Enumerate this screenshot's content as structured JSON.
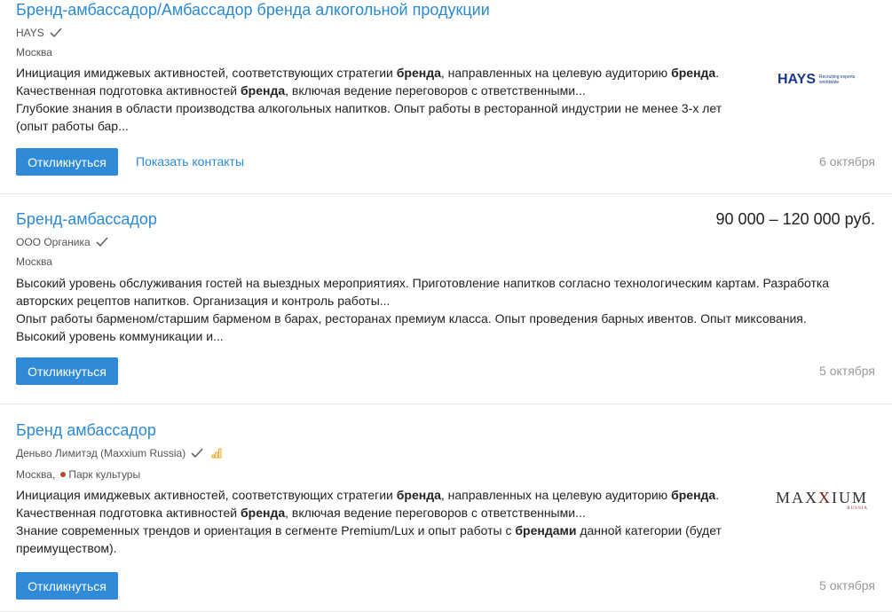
{
  "vacancies": [
    {
      "title": "Бренд-амбассадор/Амбассадор бренда алкогольной продукции",
      "company": "HAYS",
      "location": "Москва",
      "description": [
        [
          {
            "t": "Инициация имиджевых активностей, соответствующих стратегии "
          },
          {
            "t": "бренда",
            "b": true
          },
          {
            "t": ", направленных на целевую аудиторию "
          },
          {
            "t": "бренда",
            "b": true
          },
          {
            "t": "."
          }
        ],
        [
          {
            "t": "Качественная подготовка активностей "
          },
          {
            "t": "бренда",
            "b": true
          },
          {
            "t": ", включая ведение переговоров с ответственными..."
          }
        ],
        [
          {
            "t": "Глубокие знания в области производства алкогольных напитков. Опыт работы в ресторанной индустрии не менее 3-х лет (опыт работы бар..."
          }
        ]
      ],
      "apply_label": "Откликнуться",
      "contacts_label": "Показать контакты",
      "date": "6 октября",
      "logo": {
        "word": "HAYS",
        "tagline": "Recruiting experts worldwide"
      }
    },
    {
      "title": "Бренд-амбассадор",
      "salary": "90 000 – 120 000 руб.",
      "company": "ООО Органика",
      "location": "Москва",
      "description": [
        [
          {
            "t": "Высокий уровень обслуживания гостей на выездных мероприятиях. Приготовление напитков согласно технологическим картам. Разработка авторских рецептов напитков. Организация и контроль работы..."
          }
        ],
        [
          {
            "t": "Опыт работы барменом/старшим барменом в барах, ресторанах премиум класса. Опыт проведения барных ивентов. Опыт миксования. Высокий уровень коммуникации и..."
          }
        ]
      ],
      "apply_label": "Откликнуться",
      "date": "5 октября"
    },
    {
      "title": "Бренд амбассадор",
      "company": "Деньво Лимитэд (Maxxium Russia)",
      "location": "Москва,",
      "metro": "Парк культуры",
      "description": [
        [
          {
            "t": "Инициация имиджевых активностей, соответствующих стратегии "
          },
          {
            "t": "бренда",
            "b": true
          },
          {
            "t": ", направленных на целевую аудиторию "
          },
          {
            "t": "бренда",
            "b": true
          },
          {
            "t": "."
          }
        ],
        [
          {
            "t": "Качественная подготовка активностей "
          },
          {
            "t": "бренда",
            "b": true
          },
          {
            "t": ", включая ведение переговоров с ответственными..."
          }
        ],
        [
          {
            "t": "Знание современных трендов и ориентация в сегменте Premium/Lux и опыт работы с "
          },
          {
            "t": "брендами",
            "b": true
          },
          {
            "t": " данной категории (будет преимуществом)."
          }
        ]
      ],
      "apply_label": "Откликнуться",
      "date": "5 октября",
      "logo": {
        "word_a": "MAX",
        "word_x": "X",
        "word_b": "IUM",
        "sub": "RUSSIA"
      }
    }
  ],
  "colors": {
    "link": "#2a8ad8",
    "button": "#2f8ad8",
    "muted": "#999999",
    "metro_line": "#b34a2b"
  }
}
